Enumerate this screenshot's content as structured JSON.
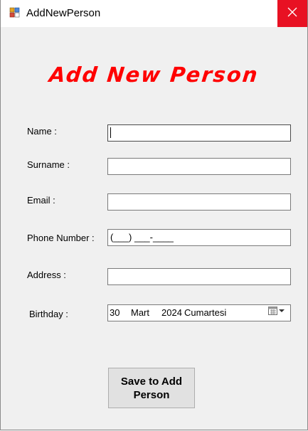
{
  "window": {
    "title": "AddNewPerson",
    "close_glyph": "✕",
    "icon": "app-form-icon"
  },
  "heading": "Add New Person",
  "form": {
    "name_label": "Name :",
    "name_value": "",
    "surname_label": "Surname :",
    "surname_value": "",
    "email_label": "Email :",
    "email_value": "",
    "phone_label": "Phone Number :",
    "phone_mask": "(___) ___-____",
    "address_label": "Address :",
    "address_value": "",
    "birthday_label": "Birthday :",
    "birthday": {
      "day": "30",
      "month": "Mart",
      "year": "2024",
      "weekday": "Cumartesi",
      "icon": "calendar-dropdown-icon"
    }
  },
  "save_button": {
    "line1": "Save to Add",
    "line2": "Person"
  },
  "colors": {
    "heading": "#ff0000",
    "close_button": "#e81123",
    "window_bg": "#f0f0f0"
  }
}
